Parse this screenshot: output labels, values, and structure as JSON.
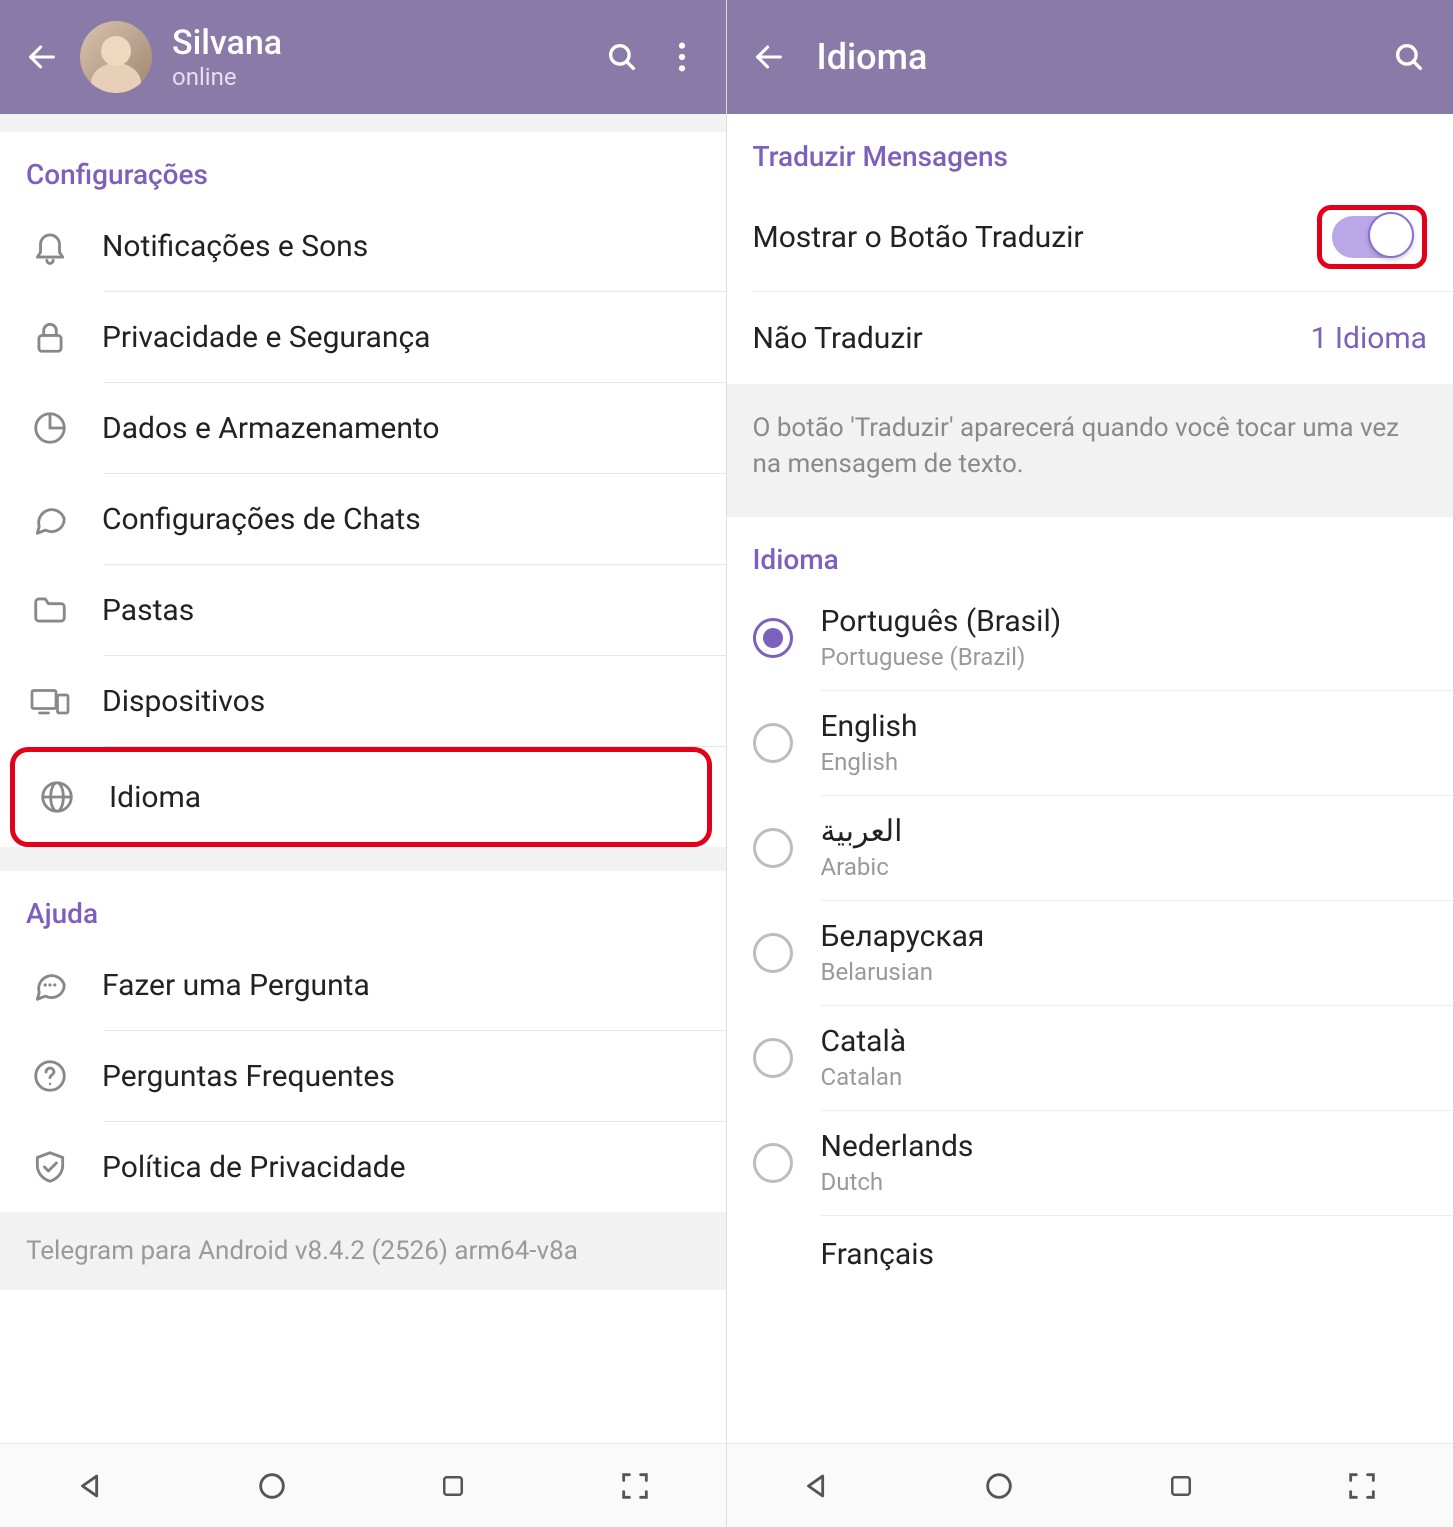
{
  "left": {
    "header": {
      "name": "Silvana",
      "status": "online"
    },
    "sections": {
      "config": {
        "title": "Configurações",
        "items": [
          {
            "icon": "bell-icon",
            "label": "Notificações e Sons"
          },
          {
            "icon": "lock-icon",
            "label": "Privacidade e Segurança"
          },
          {
            "icon": "chart-pie-icon",
            "label": "Dados e Armazenamento"
          },
          {
            "icon": "chat-bubble-icon",
            "label": "Configurações de Chats"
          },
          {
            "icon": "folder-icon",
            "label": "Pastas"
          },
          {
            "icon": "devices-icon",
            "label": "Dispositivos"
          },
          {
            "icon": "globe-icon",
            "label": "Idioma"
          }
        ]
      },
      "help": {
        "title": "Ajuda",
        "items": [
          {
            "icon": "chat-dots-icon",
            "label": "Fazer uma Pergunta"
          },
          {
            "icon": "question-circle-icon",
            "label": "Perguntas Frequentes"
          },
          {
            "icon": "shield-check-icon",
            "label": "Política de Privacidade"
          }
        ]
      }
    },
    "version": "Telegram para Android v8.4.2 (2526) arm64-v8a"
  },
  "right": {
    "header": {
      "title": "Idioma"
    },
    "translate": {
      "section_title": "Traduzir Mensagens",
      "toggle_label": "Mostrar o Botão Traduzir",
      "toggle_on": true,
      "no_translate_label": "Não Traduzir",
      "no_translate_value": "1 Idioma",
      "note": "O botão 'Traduzir' aparecerá quando você tocar uma vez na mensagem de texto."
    },
    "language": {
      "section_title": "Idioma",
      "options": [
        {
          "primary": "Português (Brasil)",
          "secondary": "Portuguese (Brazil)",
          "selected": true
        },
        {
          "primary": "English",
          "secondary": "English",
          "selected": false
        },
        {
          "primary": "العربية",
          "secondary": "Arabic",
          "selected": false
        },
        {
          "primary": "Беларуская",
          "secondary": "Belarusian",
          "selected": false
        },
        {
          "primary": "Català",
          "secondary": "Catalan",
          "selected": false
        },
        {
          "primary": "Nederlands",
          "secondary": "Dutch",
          "selected": false
        },
        {
          "primary": "Français",
          "secondary": "",
          "selected": false
        }
      ]
    }
  }
}
